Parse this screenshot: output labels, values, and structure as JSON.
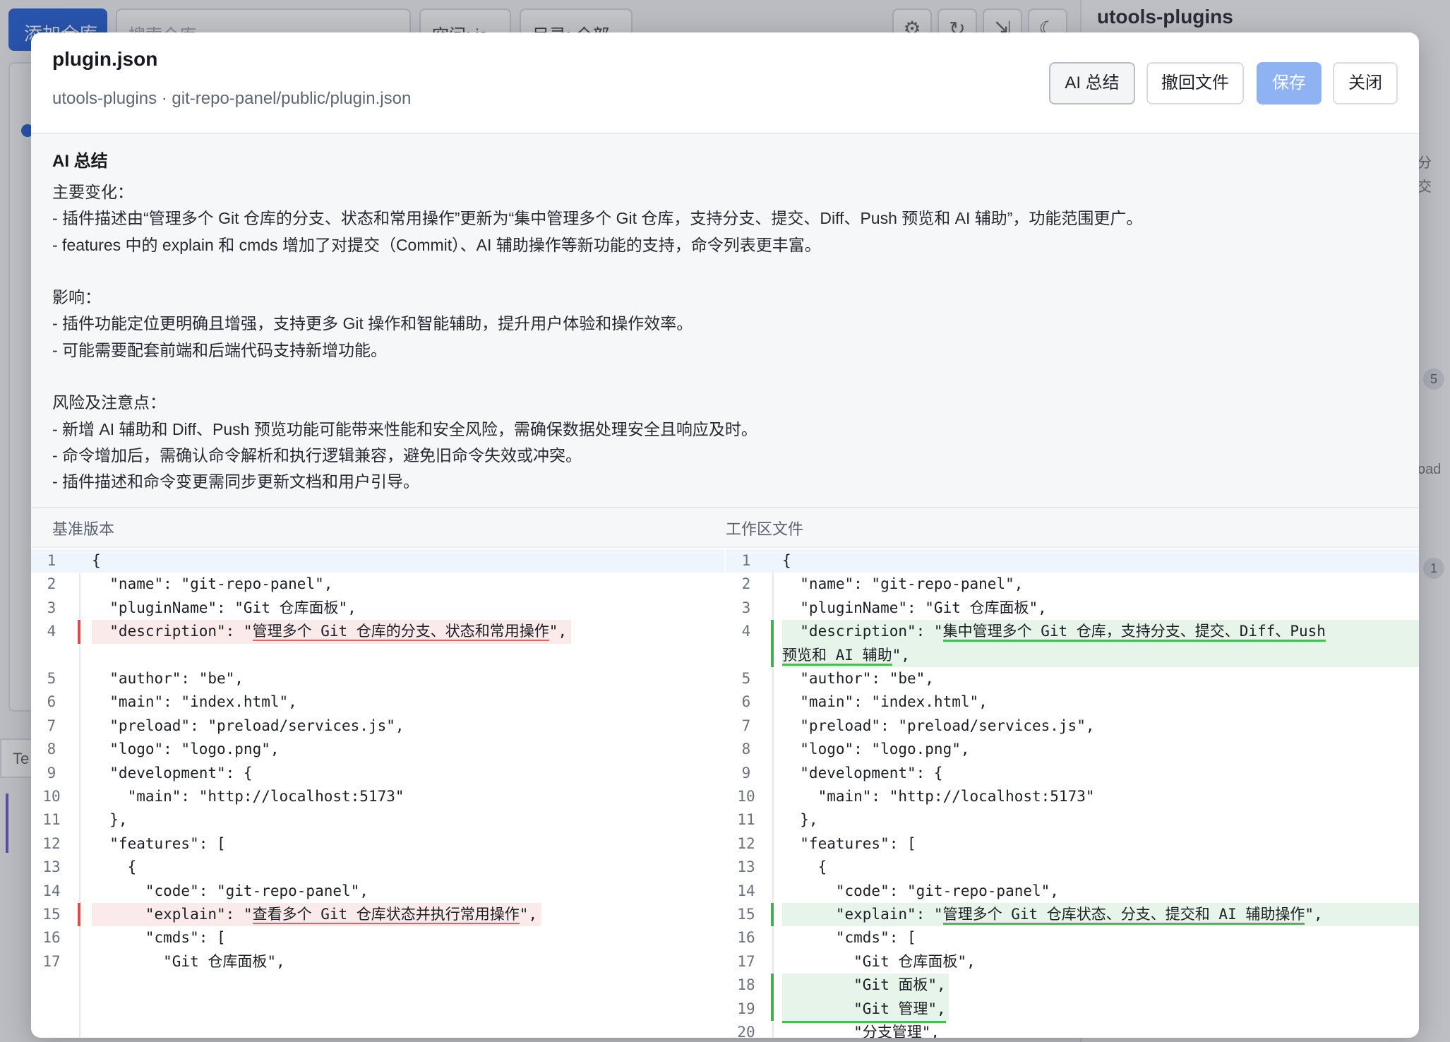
{
  "background": {
    "add_repo_label": "添加仓库",
    "search_placeholder": "搜索仓库",
    "space_select": "空间: js",
    "dir_select": "目录: 全部",
    "sidebar_title": "utools-plugins",
    "badge_1": "5",
    "badge_2": "1",
    "side_fragment_1": "分",
    "side_fragment_2": "交",
    "side_fragment_3": "oad",
    "left_tab_fragment": "Te"
  },
  "modal": {
    "title": "plugin.json",
    "subtitle": "utools-plugins · git-repo-panel/public/plugin.json",
    "buttons": {
      "ai_summary": "AI 总结",
      "revert": "撤回文件",
      "save": "保存",
      "close": "关闭"
    }
  },
  "summary": {
    "title": "AI 总结",
    "lines": [
      "主要变化：",
      "- 插件描述由“管理多个 Git 仓库的分支、状态和常用操作”更新为“集中管理多个 Git 仓库，支持分支、提交、Diff、Push 预览和 AI 辅助”，功能范围更广。",
      "- features 中的 explain 和 cmds 增加了对提交（Commit）、AI 辅助操作等新功能的支持，命令列表更丰富。",
      "",
      "影响：",
      "- 插件功能定位更明确且增强，支持更多 Git 操作和智能辅助，提升用户体验和操作效率。",
      "- 可能需要配套前端和后端代码支持新增功能。",
      "",
      "风险及注意点：",
      "- 新增 AI 辅助和 Diff、Push 预览功能可能带来性能和安全风险，需确保数据处理安全且响应及时。",
      "- 命令增加后，需确认命令解析和执行逻辑兼容，避免旧命令失效或冲突。",
      "- 插件描述和命令变更需同步更新文档和用户引导。"
    ]
  },
  "diff": {
    "left_label": "基准版本",
    "right_label": "工作区文件",
    "left": [
      {
        "no": "1",
        "text": "{"
      },
      {
        "no": "2",
        "text": "  \"name\": \"git-repo-panel\","
      },
      {
        "no": "3",
        "text": "  \"pluginName\": \"Git 仓库面板\","
      },
      {
        "no": "4",
        "pre": "  \"description\": \"",
        "hl": "管理多个 Git 仓库的分支、状态和常用操作",
        "post": "\",",
        "type": "del"
      },
      {
        "no": "",
        "text": ""
      },
      {
        "no": "5",
        "text": "  \"author\": \"be\","
      },
      {
        "no": "6",
        "text": "  \"main\": \"index.html\","
      },
      {
        "no": "7",
        "text": "  \"preload\": \"preload/services.js\","
      },
      {
        "no": "8",
        "text": "  \"logo\": \"logo.png\","
      },
      {
        "no": "9",
        "text": "  \"development\": {"
      },
      {
        "no": "10",
        "text": "    \"main\": \"http://localhost:5173\""
      },
      {
        "no": "11",
        "text": "  },"
      },
      {
        "no": "12",
        "text": "  \"features\": ["
      },
      {
        "no": "13",
        "text": "    {"
      },
      {
        "no": "14",
        "text": "      \"code\": \"git-repo-panel\","
      },
      {
        "no": "15",
        "pre": "      \"explain\": \"",
        "hl": "查看多个 Git 仓库状态并执行常用操作",
        "post": "\",",
        "type": "del"
      },
      {
        "no": "16",
        "text": "      \"cmds\": ["
      },
      {
        "no": "17",
        "text": "        \"Git 仓库面板\","
      }
    ],
    "right": [
      {
        "no": "1",
        "text": "{"
      },
      {
        "no": "2",
        "text": "  \"name\": \"git-repo-panel\","
      },
      {
        "no": "3",
        "text": "  \"pluginName\": \"Git 仓库面板\","
      },
      {
        "no": "4",
        "pre": "  \"description\": \"",
        "hl": "集中管理多个 Git 仓库，支持分支、提交、Diff、Push",
        "post": "",
        "type": "add"
      },
      {
        "no": "",
        "pre": "",
        "hl": "预览和 AI 辅助",
        "post": "\",",
        "type": "add"
      },
      {
        "no": "5",
        "text": "  \"author\": \"be\","
      },
      {
        "no": "6",
        "text": "  \"main\": \"index.html\","
      },
      {
        "no": "7",
        "text": "  \"preload\": \"preload/services.js\","
      },
      {
        "no": "8",
        "text": "  \"logo\": \"logo.png\","
      },
      {
        "no": "9",
        "text": "  \"development\": {"
      },
      {
        "no": "10",
        "text": "    \"main\": \"http://localhost:5173\""
      },
      {
        "no": "11",
        "text": "  },"
      },
      {
        "no": "12",
        "text": "  \"features\": ["
      },
      {
        "no": "13",
        "text": "    {"
      },
      {
        "no": "14",
        "text": "      \"code\": \"git-repo-panel\","
      },
      {
        "no": "15",
        "pre": "      \"explain\": \"",
        "hl": "管理多个 Git 仓库状态、分支、提交和 AI 辅助操作",
        "post": "\",",
        "type": "add"
      },
      {
        "no": "16",
        "text": "      \"cmds\": ["
      },
      {
        "no": "17",
        "text": "        \"Git 仓库面板\","
      },
      {
        "no": "18",
        "text": "        \"Git 面板\",",
        "type": "addall"
      },
      {
        "no": "19",
        "text": "        \"Git 管理\",",
        "type": "addall"
      },
      {
        "no": "20",
        "text": "        \"分支管理\","
      }
    ]
  }
}
